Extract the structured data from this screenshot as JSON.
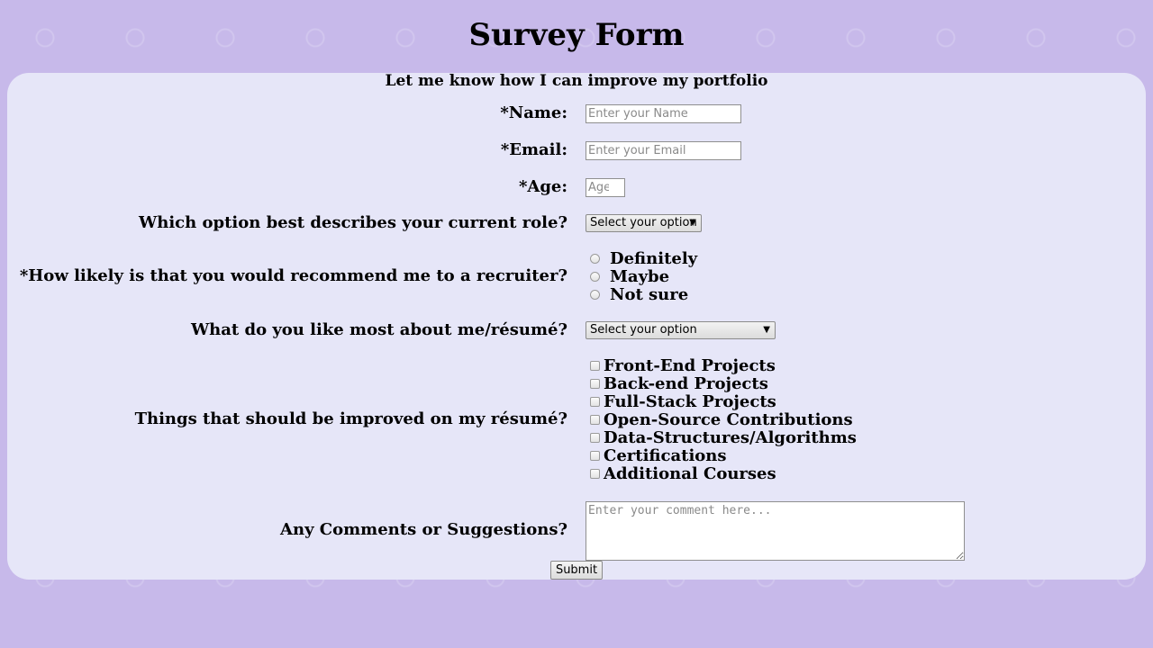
{
  "page": {
    "title": "Survey Form",
    "subtitle": "Let me know how I can improve my portfolio"
  },
  "form": {
    "name": {
      "label": "*Name:",
      "placeholder": "Enter your Name",
      "value": ""
    },
    "email": {
      "label": "*Email:",
      "placeholder": "Enter your Email",
      "value": ""
    },
    "age": {
      "label": "*Age:",
      "placeholder": "Age",
      "value": ""
    },
    "role": {
      "label": "Which option best describes your current role?",
      "selected": "Select your option"
    },
    "recommend": {
      "label": "*How likely is that you would recommend me to a recruiter?",
      "options": [
        "Definitely",
        "Maybe",
        "Not sure"
      ],
      "selected": null
    },
    "like_most": {
      "label": "What do you like most about me/résumé?",
      "selected": "Select your option"
    },
    "improve": {
      "label": "Things that should be improved on my résumé?",
      "options": [
        "Front-End Projects",
        "Back-end Projects",
        "Full-Stack Projects",
        "Open-Source Contributions",
        "Data-Structures/Algorithms",
        "Certifications",
        "Additional Courses"
      ],
      "checked": [
        false,
        false,
        false,
        false,
        false,
        false,
        false
      ]
    },
    "comments": {
      "label": "Any Comments or Suggestions?",
      "placeholder": "Enter your comment here...",
      "value": ""
    },
    "submit_label": "Submit"
  },
  "colors": {
    "page_background": "#c7b9ea",
    "panel_background": "#e6e6f8"
  }
}
